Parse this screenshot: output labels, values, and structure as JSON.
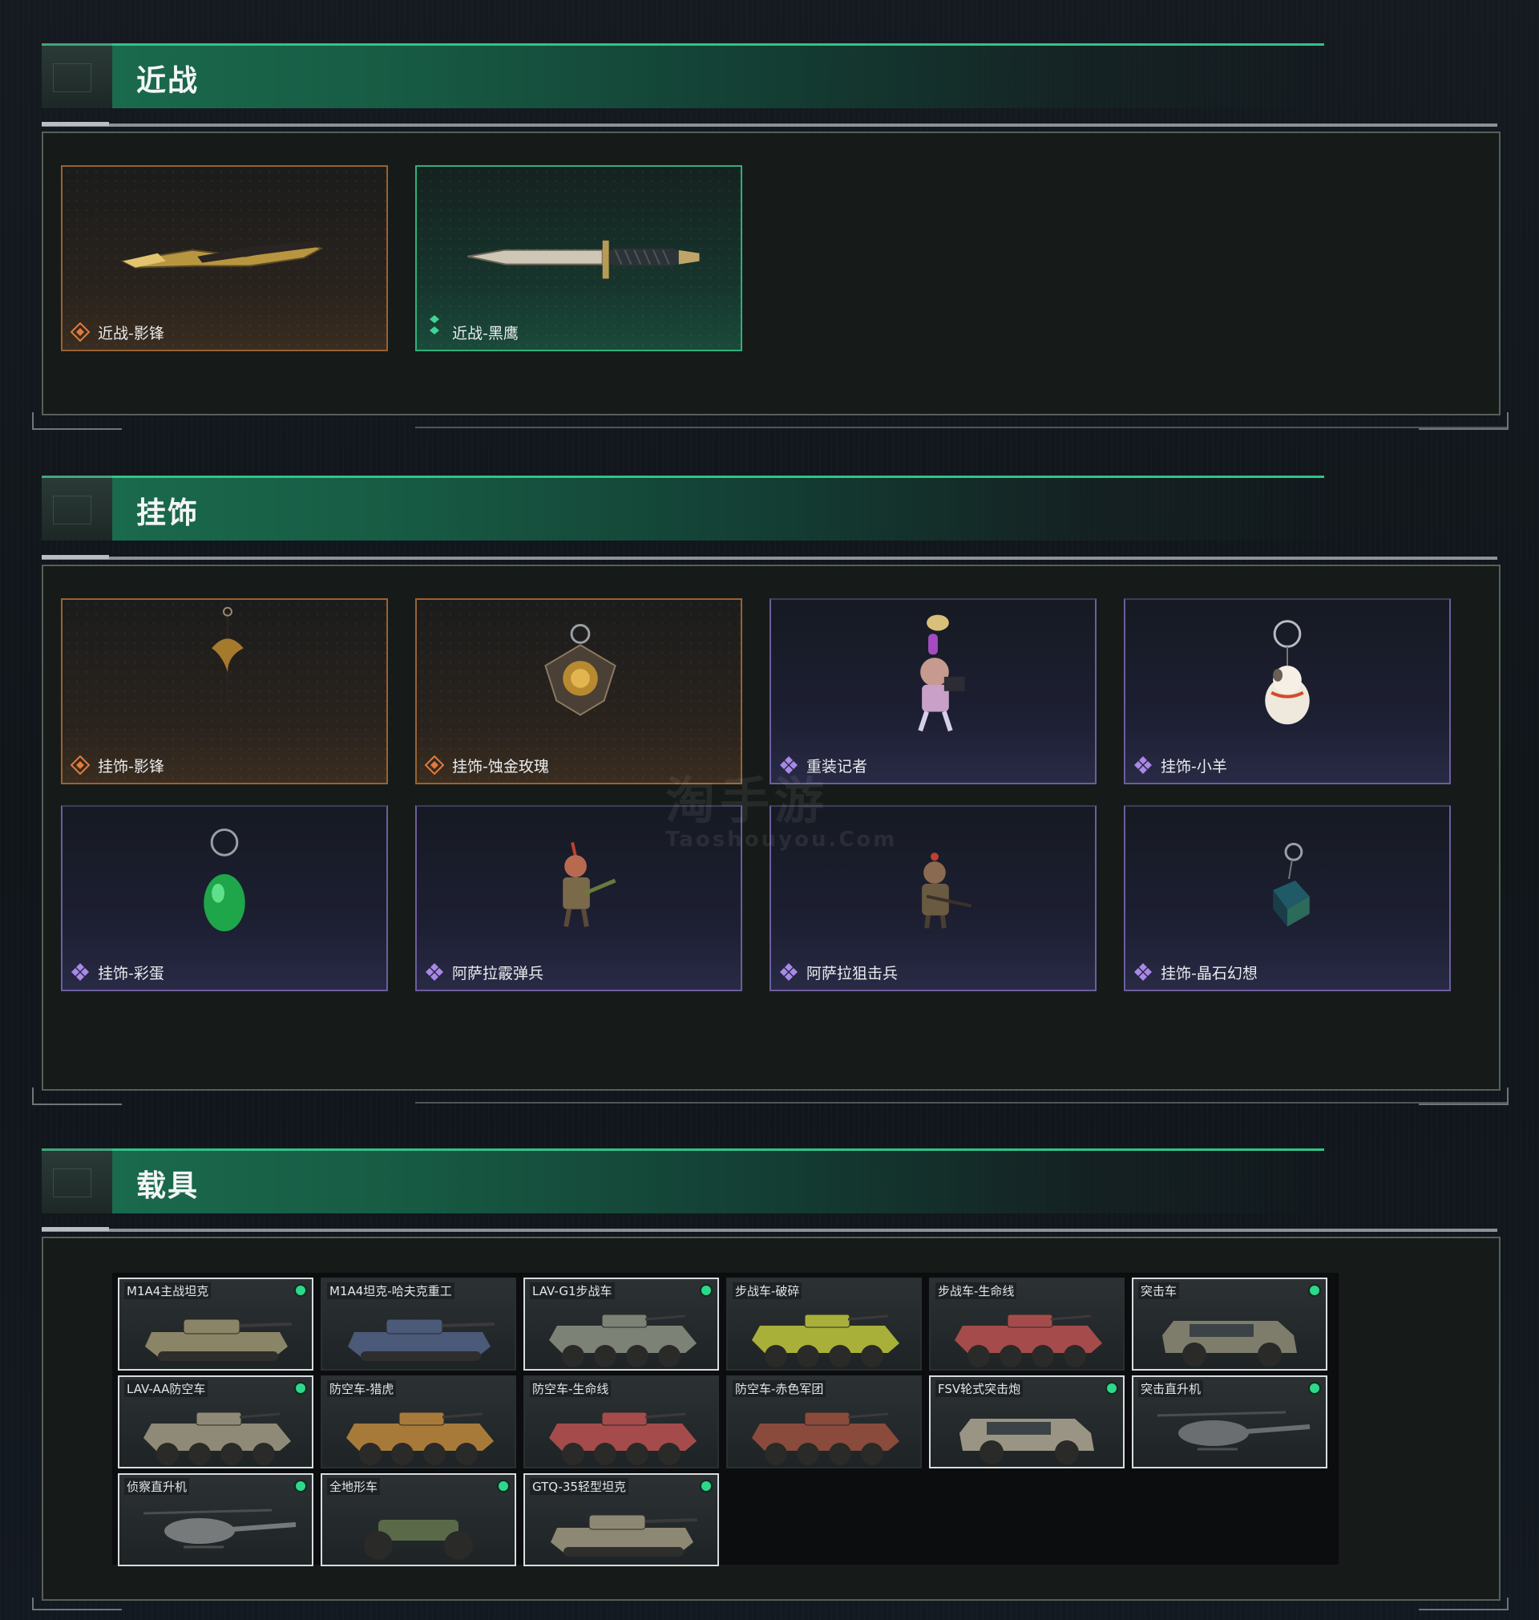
{
  "sections": {
    "melee": {
      "title": "近战"
    },
    "charms": {
      "title": "挂饰"
    },
    "vehicles": {
      "title": "载具"
    }
  },
  "melee_items": [
    {
      "label": "近战-影锋",
      "rarity": "gold"
    },
    {
      "label": "近战-黑鹰",
      "rarity": "green"
    }
  ],
  "charm_items": [
    {
      "label": "挂饰-影锋",
      "rarity": "gold"
    },
    {
      "label": "挂饰-蚀金玫瑰",
      "rarity": "gold"
    },
    {
      "label": "重装记者",
      "rarity": "purple"
    },
    {
      "label": "挂饰-小羊",
      "rarity": "purple"
    },
    {
      "label": "挂饰-彩蛋",
      "rarity": "purple"
    },
    {
      "label": "阿萨拉霰弹兵",
      "rarity": "purple"
    },
    {
      "label": "阿萨拉狙击兵",
      "rarity": "purple"
    },
    {
      "label": "挂饰-晶石幻想",
      "rarity": "purple"
    }
  ],
  "vehicle_items": [
    {
      "label": "M1A4主战坦克",
      "owned": true
    },
    {
      "label": "M1A4坦克-哈夫克重工",
      "owned": false
    },
    {
      "label": "LAV-G1步战车",
      "owned": true
    },
    {
      "label": "步战车-破碎",
      "owned": false
    },
    {
      "label": "步战车-生命线",
      "owned": false
    },
    {
      "label": "突击车",
      "owned": true
    },
    {
      "label": "LAV-AA防空车",
      "owned": true
    },
    {
      "label": "防空车-猎虎",
      "owned": false
    },
    {
      "label": "防空车-生命线",
      "owned": false
    },
    {
      "label": "防空车-赤色军团",
      "owned": false
    },
    {
      "label": "FSV轮式突击炮",
      "owned": true
    },
    {
      "label": "突击直升机",
      "owned": true
    },
    {
      "label": "侦察直升机",
      "owned": true
    },
    {
      "label": "全地形车",
      "owned": true
    },
    {
      "label": "GTQ-35轻型坦克",
      "owned": true
    }
  ],
  "watermark": {
    "main": "淘手游",
    "sub": "Taoshouyou.Com"
  },
  "colors": {
    "accent_green": "#2fc585",
    "gold_border": "#9a6232",
    "purple_border": "#6c5d9e",
    "owned_dot": "#2ed88a"
  }
}
